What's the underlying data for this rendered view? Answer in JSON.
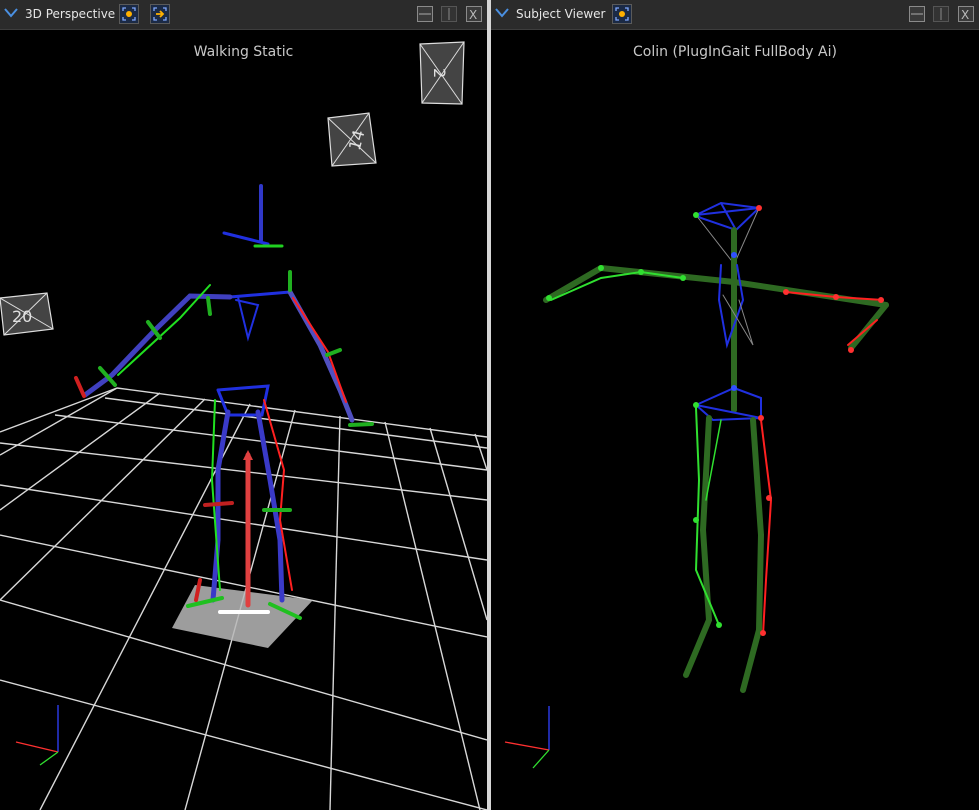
{
  "left_pane": {
    "title": "3D Perspective",
    "caption": "Walking Static",
    "camera_labels": [
      "2",
      "14",
      "20"
    ],
    "buttons": [
      "focus-button",
      "follow-button"
    ]
  },
  "right_pane": {
    "title": "Subject Viewer",
    "caption": "Colin (PlugInGait FullBody Ai)",
    "buttons": [
      "focus-button"
    ]
  },
  "window_controls": [
    "split-horizontal",
    "split-vertical",
    "close"
  ],
  "close_glyph": "X",
  "colors": {
    "background": "#000000",
    "titlebar": "#2b2b2b",
    "grid": "#d8d8d8",
    "right_side": "#ff2020",
    "left_side": "#20e020",
    "center": "#2030e0",
    "bone": "#2e6a22",
    "accent_orange": "#ffb000"
  }
}
